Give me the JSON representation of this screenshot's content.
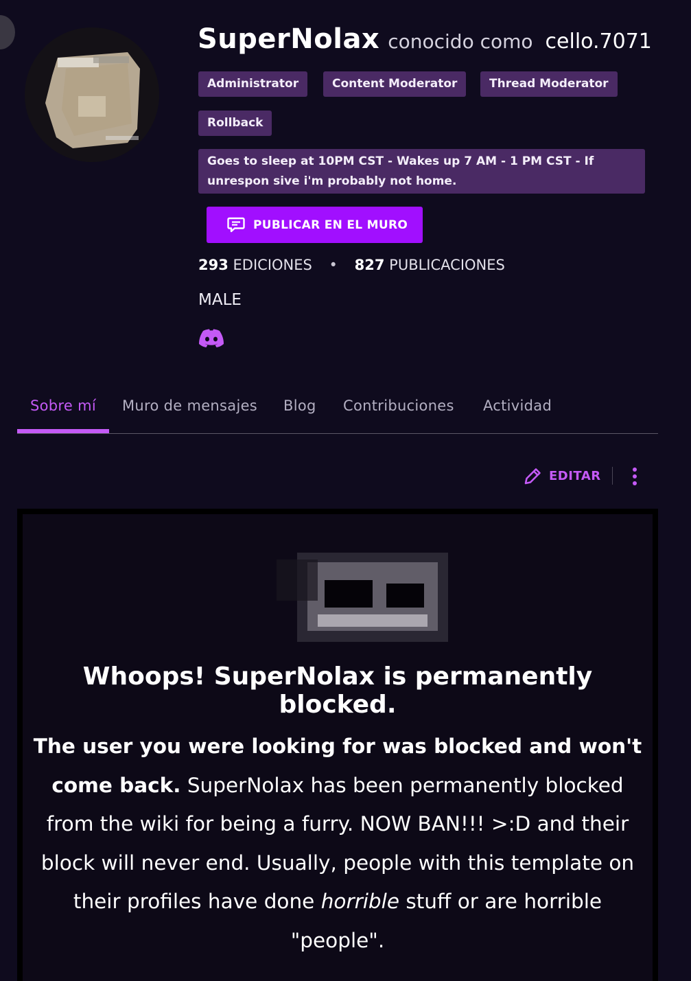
{
  "profile": {
    "username": "SuperNolax",
    "aka_label": "conocido como",
    "alias": "cello.7071",
    "tags": [
      "Administrator",
      "Content Moderator",
      "Thread Moderator",
      "Rollback"
    ],
    "status": "Goes to sleep at 10PM CST - Wakes up 7 AM - 1 PM CST - If unrespon sive i'm probably not home.",
    "wall_button": "PUBLICAR EN EL MURO",
    "edits_count": "293",
    "edits_label": "EDICIONES",
    "separator": "•",
    "posts_count": "827",
    "posts_label": "PUBLICACIONES",
    "gender": "MALE",
    "social_icon": "discord-icon"
  },
  "tabs": [
    "Sobre mí",
    "Muro de mensajes",
    "Blog",
    "Contribuciones",
    "Actividad"
  ],
  "active_tab": "Sobre mí",
  "actions": {
    "edit_label": "EDITAR",
    "more_icon": "kebab-icon",
    "edit_icon": "pencil-icon"
  },
  "block_notice": {
    "title": "Whoops! SuperNolax is permanently blocked.",
    "lead_bold": "The user you were looking for was blocked and won't come back.",
    "text_1": " SuperNolax has been permanently blocked from the wiki for being a furry. NOW BAN!!! >:D and their block will never end. Usually, people with this template on their profiles have done ",
    "emphasis": "horrible",
    "text_2": " stuff or are horrible \"people\"."
  },
  "colors": {
    "background": "#0f0b1e",
    "accent": "#c45af6",
    "button": "#a10fff",
    "tag_bg": "#4a2a64"
  }
}
